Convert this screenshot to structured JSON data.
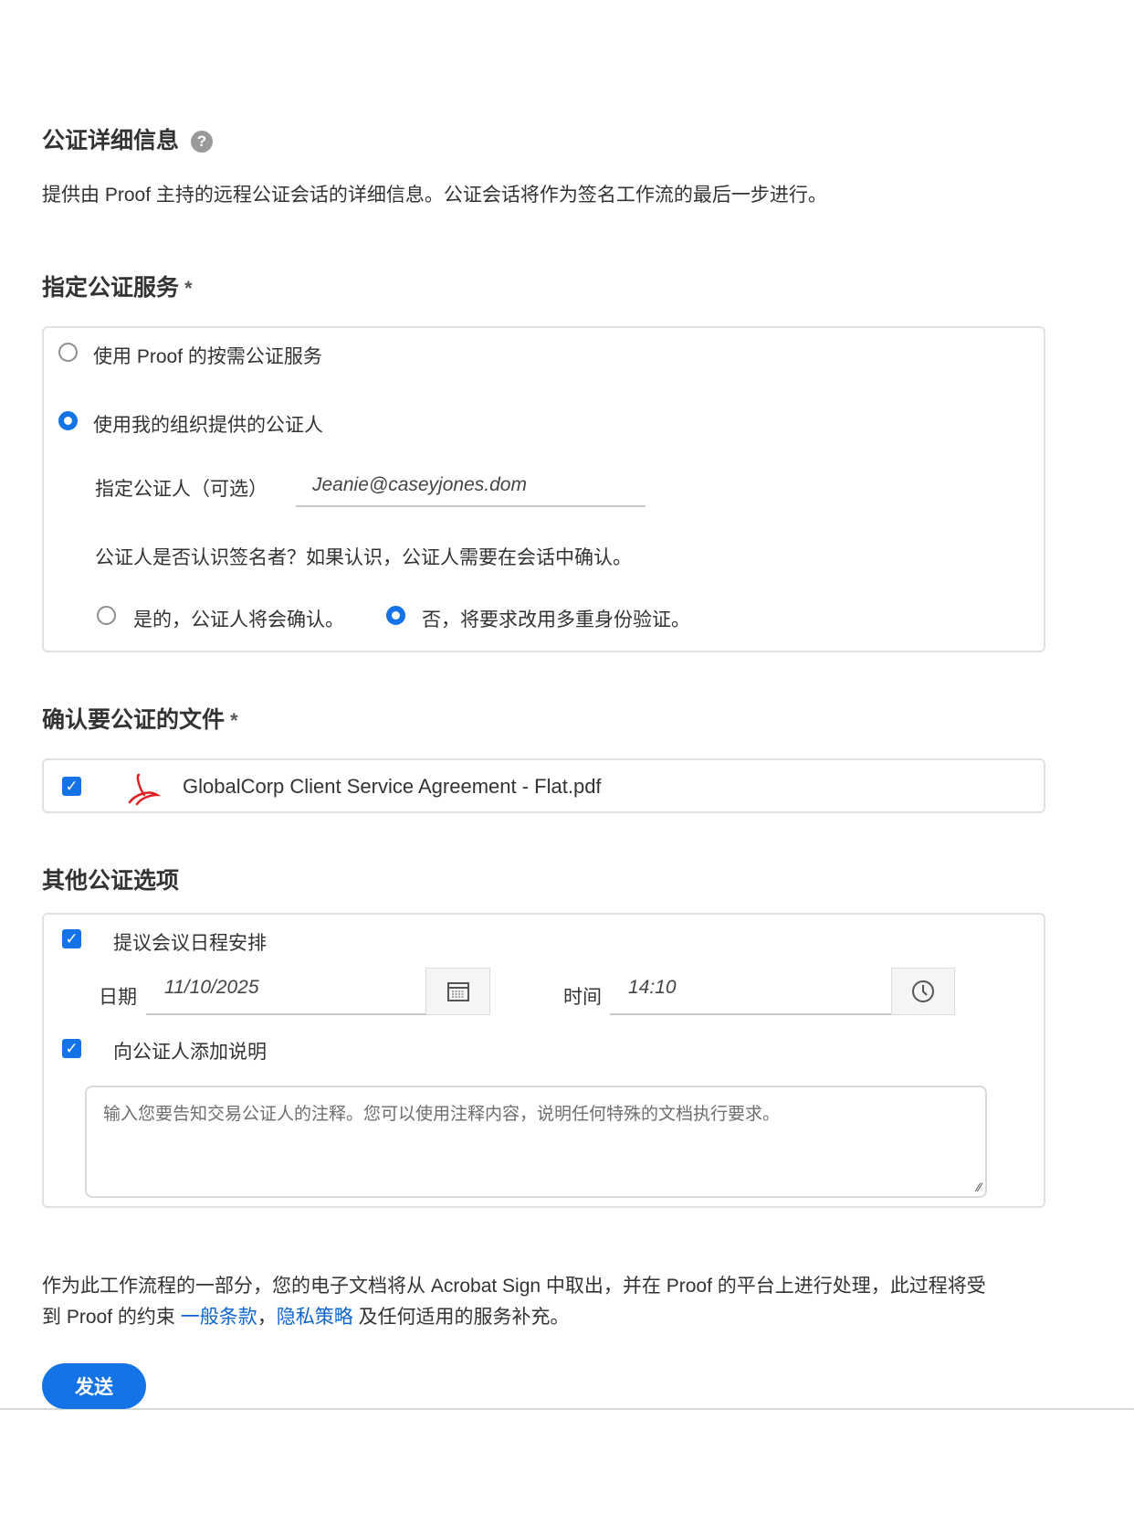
{
  "details": {
    "title": "公证详细信息",
    "description": "提供由 Proof 主持的远程公证会话的详细信息。公证会话将作为签名工作流的最后一步进行。"
  },
  "service": {
    "title": "指定公证服务",
    "required": "*",
    "options": [
      {
        "label": "使用 Proof 的按需公证服务",
        "selected": false
      },
      {
        "label": "使用我的组织提供的公证人",
        "selected": true
      }
    ],
    "notary_label": "指定公证人（可选）",
    "notary_value": "Jeanie@caseyjones.dom",
    "question": "公证人是否认识签名者？如果认识，公证人需要在会话中确认。",
    "answers": [
      {
        "label": "是的，公证人将会确认。",
        "selected": false
      },
      {
        "label": "否，将要求改用多重身份验证。",
        "selected": true
      }
    ]
  },
  "documents": {
    "title": "确认要公证的文件",
    "required": "*",
    "files": [
      {
        "name": "GlobalCorp Client Service Agreement - Flat.pdf",
        "checked": true
      }
    ]
  },
  "other": {
    "title": "其他公证选项",
    "schedule_label": "提议会议日程安排",
    "date_label": "日期",
    "date_value": "11/10/2025",
    "time_label": "时间",
    "time_value": "14:10",
    "note_label": "向公证人添加说明",
    "note_placeholder": "输入您要告知交易公证人的注释。您可以使用注释内容，说明任何特殊的文档执行要求。"
  },
  "footer": {
    "text1": "作为此工作流程的一部分，您的电子文档将从 Acrobat Sign 中取出，并在 Proof 的平台上进行处理，此过程将受",
    "text2": "到 Proof 的约束 ",
    "link1": "一般条款",
    "sep": "，",
    "link2": "隐私策略",
    "text3": " 及任何适用的服务补充。"
  },
  "send_label": "发送",
  "colors": {
    "accent": "#1473e6",
    "link": "#0d66d0"
  }
}
